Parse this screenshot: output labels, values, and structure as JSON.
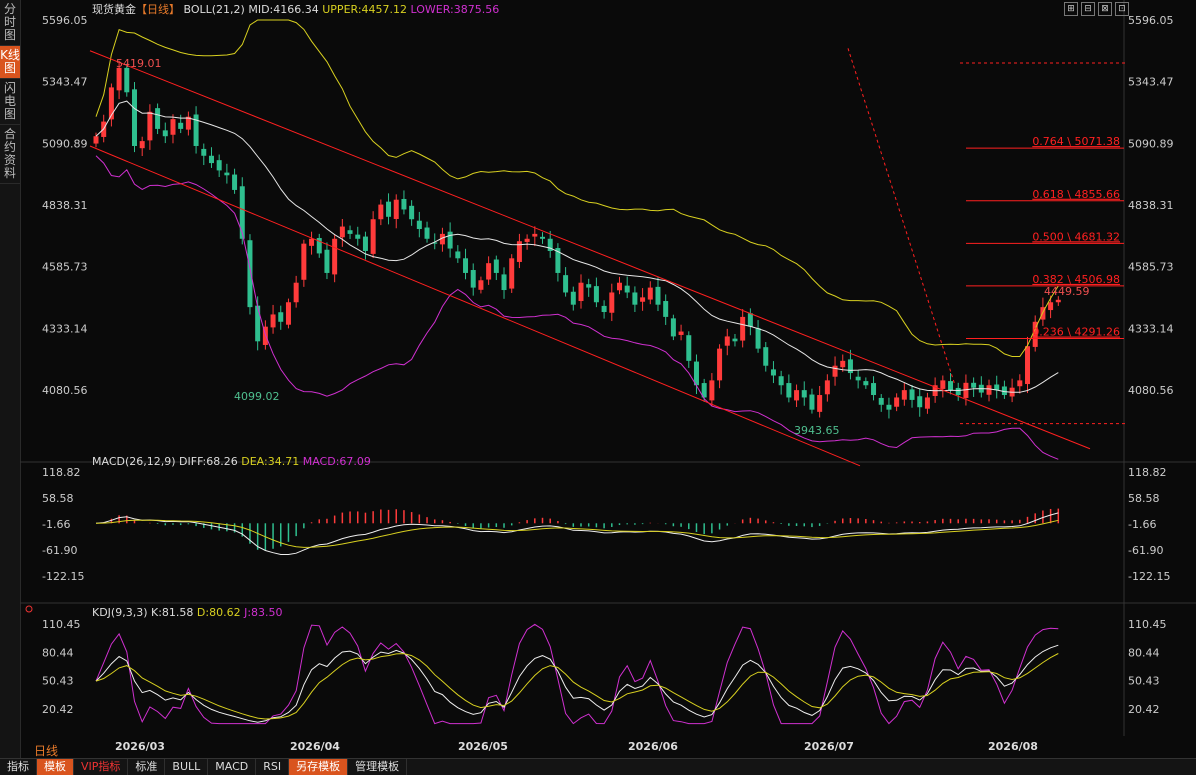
{
  "sidebar": [
    {
      "label": "分时图",
      "active": false
    },
    {
      "label": "K线图",
      "active": true
    },
    {
      "label": "闪电图",
      "active": false
    },
    {
      "label": "合约资料",
      "active": false
    }
  ],
  "header": {
    "title": "现货黄金",
    "period": "【日线】",
    "indicator": "BOLL(21,2)",
    "mid": "MID:4166.34",
    "upper": "UPPER:4457.12",
    "lower": "LOWER:3875.56"
  },
  "window_buttons": [
    "⊞",
    "⊟",
    "⊠",
    "⊡"
  ],
  "price_axis": {
    "labels": [
      "5596.05",
      "5343.47",
      "5090.89",
      "4838.31",
      "4585.73",
      "4333.14",
      "4080.56"
    ],
    "values": [
      5596.05,
      5343.47,
      5090.89,
      4838.31,
      4585.73,
      4333.14,
      4080.56
    ]
  },
  "price_annotations": {
    "high": "5419.01",
    "low1": "4099.02",
    "low2": "3943.65",
    "last": "4449.59"
  },
  "fib_levels": [
    {
      "label": "0.764 \\ 5071.38",
      "value": 5071.38
    },
    {
      "label": "0.618 \\ 4855.66",
      "value": 4855.66
    },
    {
      "label": "0.500 \\ 4681.32",
      "value": 4681.32
    },
    {
      "label": "0.382 \\ 4506.98",
      "value": 4506.98
    },
    {
      "label": "0.236 \\ 4291.26",
      "value": 4291.26
    }
  ],
  "macd": {
    "header": "MACD(26,12,9)",
    "diff": "DIFF:68.26",
    "dea": "DEA:34.71",
    "macd": "MACD:67.09",
    "labels": [
      "118.82",
      "58.58",
      "-1.66",
      "-61.90",
      "-122.15"
    ],
    "values": [
      118.82,
      58.58,
      -1.66,
      -61.9,
      -122.15
    ]
  },
  "kdj": {
    "header": "KDJ(9,3,3)",
    "k": "K:81.58",
    "d": "D:80.62",
    "j": "J:83.50",
    "labels": [
      "110.45",
      "80.44",
      "50.43",
      "20.42"
    ],
    "values": [
      110.45,
      80.44,
      50.43,
      20.42
    ]
  },
  "x_labels": [
    "2026/03",
    "2026/04",
    "2026/05",
    "2026/06",
    "2026/07",
    "2026/08"
  ],
  "period_label": "日线",
  "bottom_tabs": [
    {
      "label": "指标",
      "style": "normal"
    },
    {
      "label": "模板",
      "style": "active"
    },
    {
      "label": "VIP指标",
      "style": "vip"
    },
    {
      "label": "标准",
      "style": "normal"
    },
    {
      "label": "BULL",
      "style": "normal"
    },
    {
      "label": "MACD",
      "style": "normal"
    },
    {
      "label": "RSI",
      "style": "normal"
    },
    {
      "label": "另存模板",
      "style": "active"
    },
    {
      "label": "管理模板",
      "style": "normal"
    }
  ],
  "colors": {
    "up": "#ff3b3b",
    "down": "#2fbf8f",
    "mid": "#e6e6e6",
    "upper": "#d8d020",
    "lower": "#d030d0",
    "fib": "#ff2020",
    "channel": "#ff2020"
  },
  "chart_data": {
    "type": "candlestick",
    "close": [
      5120,
      5180,
      5320,
      5400,
      5300,
      5080,
      5100,
      5220,
      5150,
      5120,
      5190,
      5150,
      5200,
      5080,
      5040,
      5010,
      4980,
      4960,
      4900,
      4700,
      4420,
      4280,
      4340,
      4390,
      4360,
      4440,
      4520,
      4680,
      4700,
      4640,
      4560,
      4700,
      4750,
      4720,
      4700,
      4650,
      4780,
      4840,
      4790,
      4860,
      4820,
      4780,
      4740,
      4700,
      4680,
      4720,
      4660,
      4620,
      4560,
      4500,
      4530,
      4600,
      4560,
      4490,
      4620,
      4690,
      4700,
      4720,
      4700,
      4650,
      4560,
      4480,
      4430,
      4520,
      4500,
      4440,
      4400,
      4480,
      4520,
      4480,
      4430,
      4460,
      4500,
      4430,
      4380,
      4300,
      4320,
      4200,
      4100,
      4050,
      4120,
      4250,
      4300,
      4280,
      4380,
      4340,
      4250,
      4180,
      4140,
      4100,
      4050,
      4080,
      4050,
      4000,
      4060,
      4120,
      4180,
      4200,
      4150,
      4120,
      4100,
      4060,
      4020,
      4000,
      4050,
      4080,
      4040,
      4010,
      4050,
      4100,
      4120,
      4080,
      4060,
      4110,
      4090,
      4070,
      4100,
      4080,
      4060,
      4090,
      4120,
      4260,
      4360,
      4420,
      4440,
      4450
    ]
  }
}
